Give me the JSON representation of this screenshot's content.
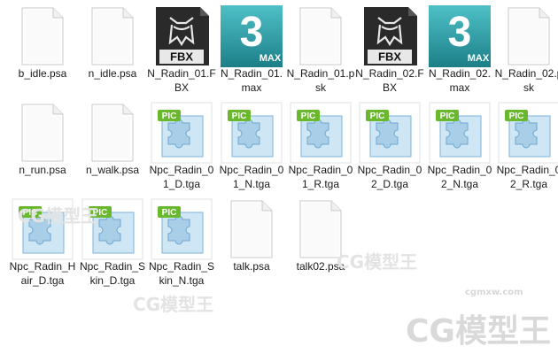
{
  "files": [
    {
      "name": "b_idle.psa",
      "type": "blank"
    },
    {
      "name": "n_idle.psa",
      "type": "blank"
    },
    {
      "name": "N_Radin_01.FBX",
      "type": "fbx",
      "badge": "FBX"
    },
    {
      "name": "N_Radin_01.max",
      "type": "max",
      "badge": "MAX",
      "digit": "3"
    },
    {
      "name": "N_Radin_01.psk",
      "type": "blank"
    },
    {
      "name": "N_Radin_02.FBX",
      "type": "fbx",
      "badge": "FBX"
    },
    {
      "name": "N_Radin_02.max",
      "type": "max",
      "badge": "MAX",
      "digit": "3"
    },
    {
      "name": "N_Radin_02.psk",
      "type": "blank"
    },
    {
      "name": "n_run.psa",
      "type": "blank"
    },
    {
      "name": "n_walk.psa",
      "type": "blank"
    },
    {
      "name": "Npc_Radin_01_D.tga",
      "type": "pic",
      "badge": "PIC"
    },
    {
      "name": "Npc_Radin_01_N.tga",
      "type": "pic",
      "badge": "PIC"
    },
    {
      "name": "Npc_Radin_01_R.tga",
      "type": "pic",
      "badge": "PIC"
    },
    {
      "name": "Npc_Radin_02_D.tga",
      "type": "pic",
      "badge": "PIC"
    },
    {
      "name": "Npc_Radin_02_N.tga",
      "type": "pic",
      "badge": "PIC"
    },
    {
      "name": "Npc_Radin_02_R.tga",
      "type": "pic",
      "badge": "PIC"
    },
    {
      "name": "Npc_Radin_Hair_D.tga",
      "type": "pic",
      "badge": "PIC"
    },
    {
      "name": "Npc_Radin_Skin_D.tga",
      "type": "pic",
      "badge": "PIC"
    },
    {
      "name": "Npc_Radin_Skin_N.tga",
      "type": "pic",
      "badge": "PIC"
    },
    {
      "name": "talk.psa",
      "type": "blank"
    },
    {
      "name": "talk02.psa",
      "type": "blank"
    }
  ],
  "colors": {
    "fbx_dark": "#2a2a2a",
    "max_teal": "#1c7f88",
    "pic_green": "#6ab82e",
    "puzzle_blue": "#a9cfe8"
  },
  "watermark": {
    "text": "CG模型王",
    "url": "cgmxw.com"
  }
}
